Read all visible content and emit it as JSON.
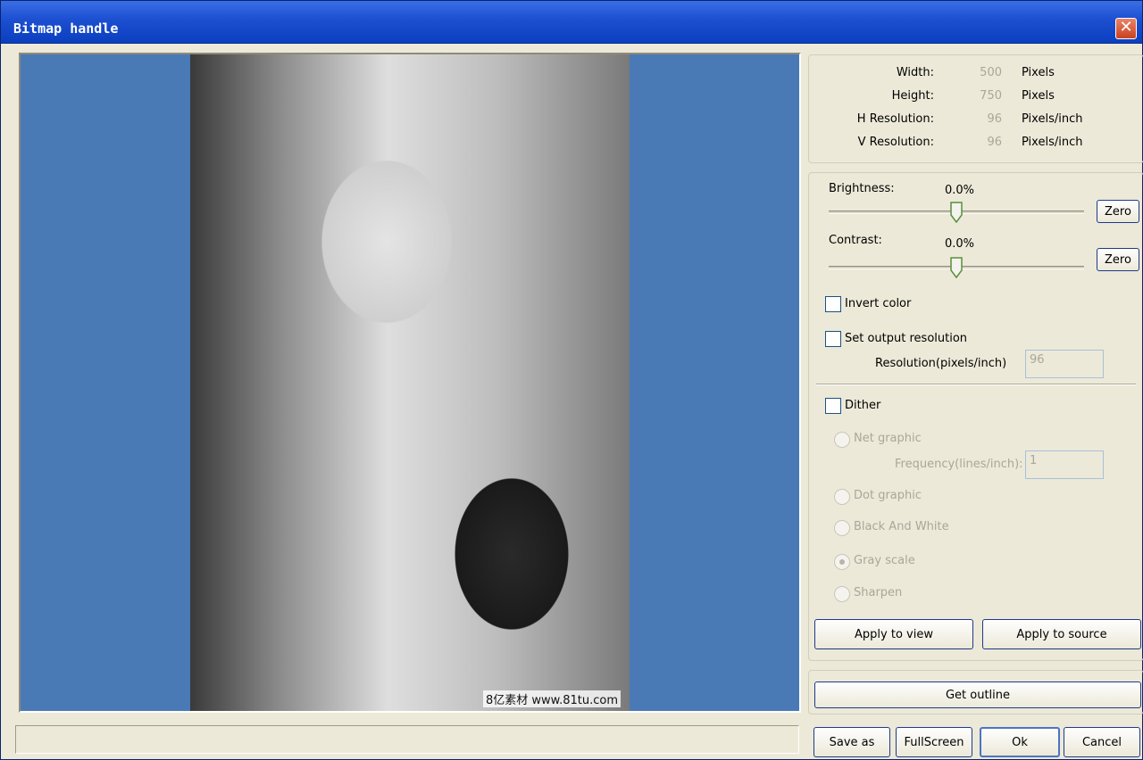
{
  "window": {
    "title": "Bitmap handle",
    "close_glyph": "✕"
  },
  "preview": {
    "watermark": "8亿素材 www.81tu.com"
  },
  "image_info": {
    "rows": [
      {
        "label": "Width:",
        "value": "500",
        "unit": "Pixels"
      },
      {
        "label": "Height:",
        "value": "750",
        "unit": "Pixels"
      },
      {
        "label": "H Resolution:",
        "value": "96",
        "unit": "Pixels/inch"
      },
      {
        "label": "V Resolution:",
        "value": "96",
        "unit": "Pixels/inch"
      }
    ]
  },
  "adjust": {
    "brightness_label": "Brightness:",
    "brightness_value": "0.0%",
    "brightness_level": 0.0,
    "contrast_label": "Contrast:",
    "contrast_value": "0.0%",
    "contrast_level": 0.0,
    "zero_label": "Zero",
    "invert_label": "Invert color",
    "invert_checked": false,
    "set_output_label": "Set output resolution",
    "set_output_checked": false,
    "resolution_label": "Resolution(pixels/inch)",
    "resolution_value": "96"
  },
  "dither": {
    "label": "Dither",
    "checked": false,
    "net_graphic": "Net graphic",
    "frequency_label": "Frequency(lines/inch):",
    "frequency_value": "1",
    "dot_graphic": "Dot graphic",
    "black_white": "Black And White",
    "gray_scale": "Gray scale",
    "sharpen": "Sharpen",
    "selected": "Gray scale"
  },
  "buttons": {
    "apply_view": "Apply to view",
    "apply_source": "Apply to source",
    "get_outline": "Get outline",
    "save_as": "Save as",
    "fullscreen": "FullScreen",
    "ok": "Ok",
    "cancel": "Cancel"
  },
  "colors": {
    "title_bar": "#1c4fd0",
    "preview_bg": "#4a7ab6",
    "dialog_bg": "#ece9d8"
  }
}
